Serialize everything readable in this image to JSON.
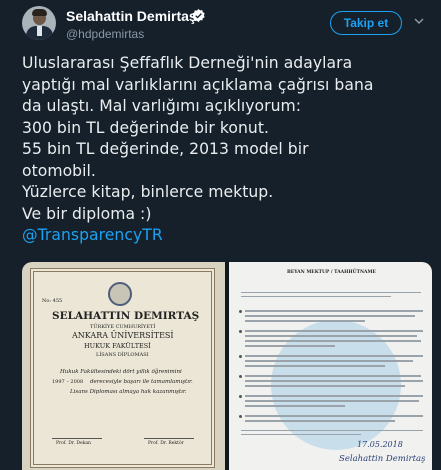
{
  "author": {
    "name": "Selahattin Demirtaş",
    "handle": "@hdpdemirtas",
    "verified": true
  },
  "follow_button": {
    "label": "Takip et"
  },
  "tweet": {
    "lines": [
      "Uluslararası Şeffaflık Derneği'nin adaylara",
      "yaptığı mal varlıklarını açıklama çağrısı bana",
      "da ulaştı. Mal varlığımı açıklıyorum:",
      "300 bin TL değerinde bir konut.",
      "55 bin TL değerinde, 2013 model bir",
      "otomobil.",
      "Yüzlerce kitap, binlerce mektup.",
      "Ve bir diploma :)"
    ],
    "mention": "@TransparencyTR"
  },
  "media": {
    "diploma": {
      "name": "SELAHATTIN DEMIRTAŞ",
      "country": "TÜRKİYE CUMHURİYETİ",
      "university": "ANKARA ÜNİVERSİTESİ",
      "faculty": "HUKUK FAKÜLTESİ",
      "diploma_type": "LİSANS DİPLOMASI",
      "number": "No: 455",
      "body_lines": [
        "Hukuk Fakültesindeki dört yıllık öğrenimini",
        "derecesiyle başarı ile tamamlamıştır.",
        "Lisans Diploması almaya hak kazanmıştır."
      ],
      "date": "1997 – 2008",
      "signatories": [
        "Prof. Dr. Dekan",
        "Prof. Dr. Rektör"
      ]
    },
    "declaration": {
      "title": "BEYAN MEKTUP / TAAHHÜTNAME",
      "date": "17.05.2018",
      "signature": "Selahattin Demirtaş"
    }
  },
  "colors": {
    "background": "#15202b",
    "accent": "#1da1f2",
    "secondary_text": "#8899a6"
  }
}
